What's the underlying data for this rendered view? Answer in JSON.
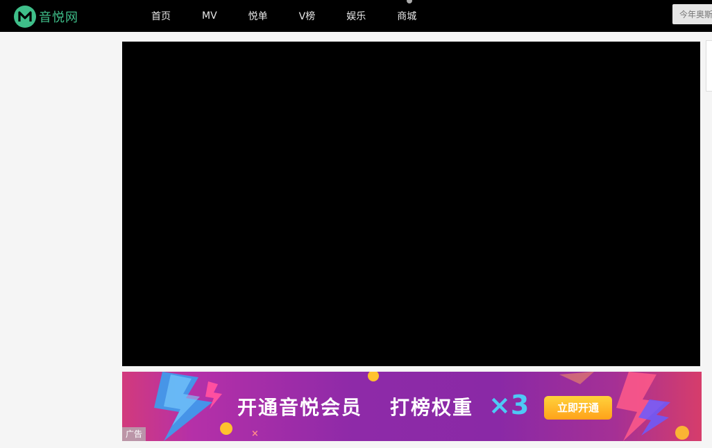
{
  "header": {
    "logo_text": "音悦网",
    "nav": [
      "首页",
      "MV",
      "悦单",
      "V榜",
      "娱乐",
      "商城"
    ],
    "search_placeholder": "今年奥斯"
  },
  "banner": {
    "headline_part1": "开通音悦会员",
    "headline_part2": "打榜权重",
    "multiplier": "×3",
    "cta_label": "立即开通",
    "ad_label": "广告",
    "close_glyph": "×"
  },
  "colors": {
    "brand_green": "#3fbf8a",
    "topbar_bg": "#000000",
    "banner_purple": "#8e2aa8",
    "cta_orange": "#ffa21a",
    "multiplier_blue": "#4ec9f5"
  }
}
